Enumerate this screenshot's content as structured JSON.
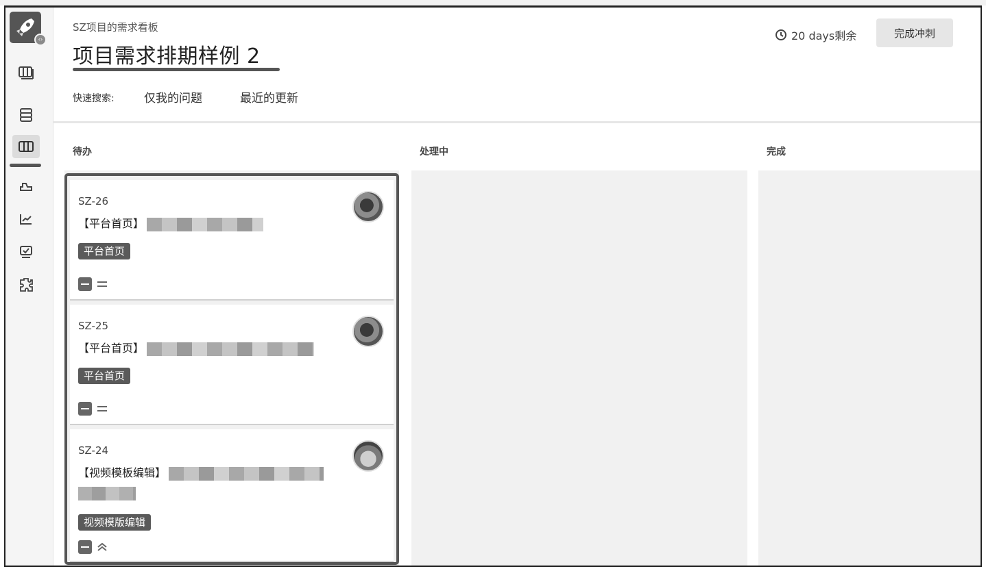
{
  "header": {
    "project_name": "SZ项目的需求看板",
    "board_title": "项目需求排期样例 2",
    "quick_search_label": "快速搜索:",
    "quick_filters": [
      "仅我的问题",
      "最近的更新"
    ],
    "days_remaining": "20 days剩余",
    "complete_sprint_button": "完成冲刺"
  },
  "columns": [
    {
      "title": "待办"
    },
    {
      "title": "处理中"
    },
    {
      "title": "完成"
    }
  ],
  "cards": [
    {
      "key": "SZ-26",
      "summary_prefix": "【平台首页】",
      "label": "平台首页",
      "priority_icon": "medium-priority-icon"
    },
    {
      "key": "SZ-25",
      "summary_prefix": "【平台首页】",
      "label": "平台首页",
      "priority_icon": "medium-priority-icon"
    },
    {
      "key": "SZ-24",
      "summary_prefix": "【视频模板编辑】",
      "label": "视频模版编辑",
      "priority_icon": "high-priority-icon"
    }
  ],
  "nav_icons": [
    "backlog-icon",
    "issues-icon",
    "board-icon",
    "releases-icon",
    "reports-icon",
    "components-icon",
    "add-ons-icon"
  ],
  "colors": {
    "label_bg": "#5a5a5a",
    "column_bg": "#f1f1f1",
    "accent": "#555555"
  }
}
